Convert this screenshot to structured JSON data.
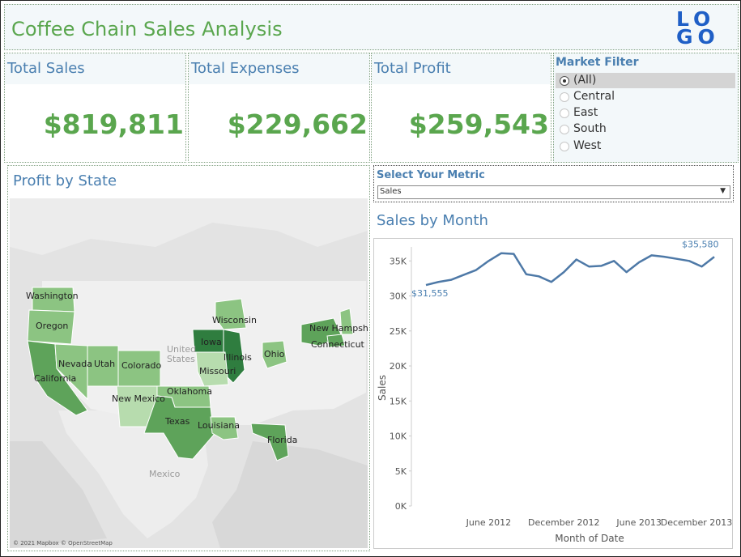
{
  "header": {
    "title": "Coffee Chain Sales Analysis",
    "logo_lines": [
      "LO",
      "GO"
    ]
  },
  "kpis": [
    {
      "label": "Total Sales",
      "value": "$819,811"
    },
    {
      "label": "Total Expenses",
      "value": "$229,662"
    },
    {
      "label": "Total Profit",
      "value": "$259,543"
    }
  ],
  "market_filter": {
    "title": "Market Filter",
    "options": [
      "(All)",
      "Central",
      "East",
      "South",
      "West"
    ],
    "selected": "(All)"
  },
  "map": {
    "title": "Profit by State",
    "attribution": "© 2021 Mapbox © OpenStreetMap",
    "background_labels": [
      "United",
      "States",
      "Mexico"
    ],
    "states": [
      "Washington",
      "Oregon",
      "California",
      "Nevada",
      "Utah",
      "Colorado",
      "New Mexico",
      "Oklahoma",
      "Texas",
      "Louisiana",
      "Florida",
      "Iowa",
      "Illinois",
      "Missouri",
      "Wisconsin",
      "Ohio",
      "New Hampshire",
      "Connecticut"
    ],
    "colors": {
      "dark": "#2f7d3f",
      "mid": "#5ea35a",
      "light": "#8cc482",
      "pale": "#b7dcae"
    }
  },
  "metric_selector": {
    "title": "Select Your Metric",
    "value": "Sales"
  },
  "line_chart": {
    "title": "Sales by Month"
  },
  "chart_data": {
    "type": "line",
    "x": [
      "2012-01",
      "2012-02",
      "2012-03",
      "2012-04",
      "2012-05",
      "2012-06",
      "2012-07",
      "2012-08",
      "2012-09",
      "2012-10",
      "2012-11",
      "2012-12",
      "2013-01",
      "2013-02",
      "2013-03",
      "2013-04",
      "2013-05",
      "2013-06",
      "2013-07",
      "2013-08",
      "2013-09",
      "2013-10",
      "2013-11",
      "2013-12"
    ],
    "series": [
      {
        "values": [
          31555,
          32000,
          32300,
          33000,
          33700,
          35000,
          36100,
          36000,
          33100,
          32800,
          32000,
          33400,
          35200,
          34200,
          34300,
          35000,
          33400,
          34800,
          35800,
          35600,
          35300,
          35000,
          34200,
          35580
        ]
      }
    ],
    "xticks": [
      "June 2012",
      "December 2012",
      "June 2013",
      "December 2013"
    ],
    "yticks": [
      "0K",
      "5K",
      "10K",
      "15K",
      "20K",
      "25K",
      "30K",
      "35K"
    ],
    "ylim": [
      0,
      37000
    ],
    "xlabel": "Month of Date",
    "ylabel": "Sales",
    "start_label": "$31,555",
    "end_label": "$35,580",
    "line_color": "#4e79a7",
    "grid": false
  }
}
